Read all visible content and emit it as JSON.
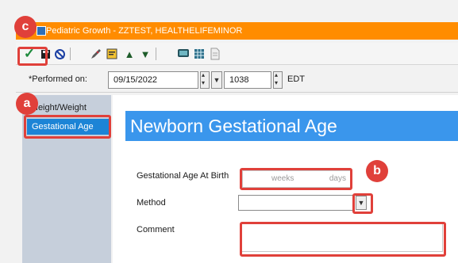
{
  "window": {
    "title": "Pediatric Growth - ZZTEST, HEALTHELIFEMINOR",
    "title_bar_color": "#ff8c00"
  },
  "toolbar": {
    "icons": [
      "checkmark-icon",
      "save-icon",
      "cancel-icon",
      "pencil-icon",
      "note-icon",
      "arrow-up-icon",
      "arrow-down-icon",
      "monitor-icon",
      "table-icon",
      "document-icon"
    ]
  },
  "performed": {
    "label": "*Performed on:",
    "date": "09/15/2022",
    "time": "1038",
    "timezone": "EDT"
  },
  "sidebar": {
    "items": [
      {
        "label": "Height/Weight"
      },
      {
        "label": "Gestational Age"
      }
    ],
    "active_color": "#1c84d6"
  },
  "main": {
    "section_title": "Newborn Gestational Age",
    "header_color": "#3a96ec",
    "fields": {
      "gestational_age": {
        "label": "Gestational Age At Birth",
        "weeks_placeholder": "weeks",
        "days_placeholder": "days"
      },
      "method": {
        "label": "Method",
        "value": ""
      },
      "comment": {
        "label": "Comment",
        "value": ""
      }
    }
  },
  "callouts": {
    "a": "a",
    "b": "b",
    "c": "c",
    "color": "#e0403a"
  }
}
